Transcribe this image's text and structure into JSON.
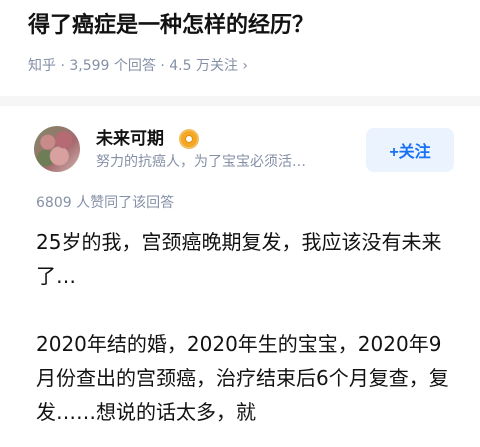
{
  "question": {
    "title": "得了癌症是一种怎样的经历？",
    "source": "知乎",
    "answers": "3,599 个回答",
    "followers": "4.5 万关注",
    "separator": " · ",
    "chevron": "›"
  },
  "author": {
    "name": "未来可期",
    "bio": "努力的抗癌人，为了宝宝必须活…",
    "badge_icon": "verified-badge-icon",
    "follow_label": "+关注"
  },
  "answer": {
    "likes_text": "6809 人赞同了该回答",
    "paragraph1": "25岁的我，宫颈癌晚期复发，我应该没有未来了…",
    "paragraph2": "2020年结的婚，2020年生的宝宝，2020年9月份查出的宫颈癌，治疗结束后6个月复查，复发……想说的话太多，就"
  },
  "colors": {
    "accent": "#1772f6",
    "follow_bg": "#ebf3fe",
    "meta_gray": "#8590a6",
    "badge": "#f5a623"
  }
}
